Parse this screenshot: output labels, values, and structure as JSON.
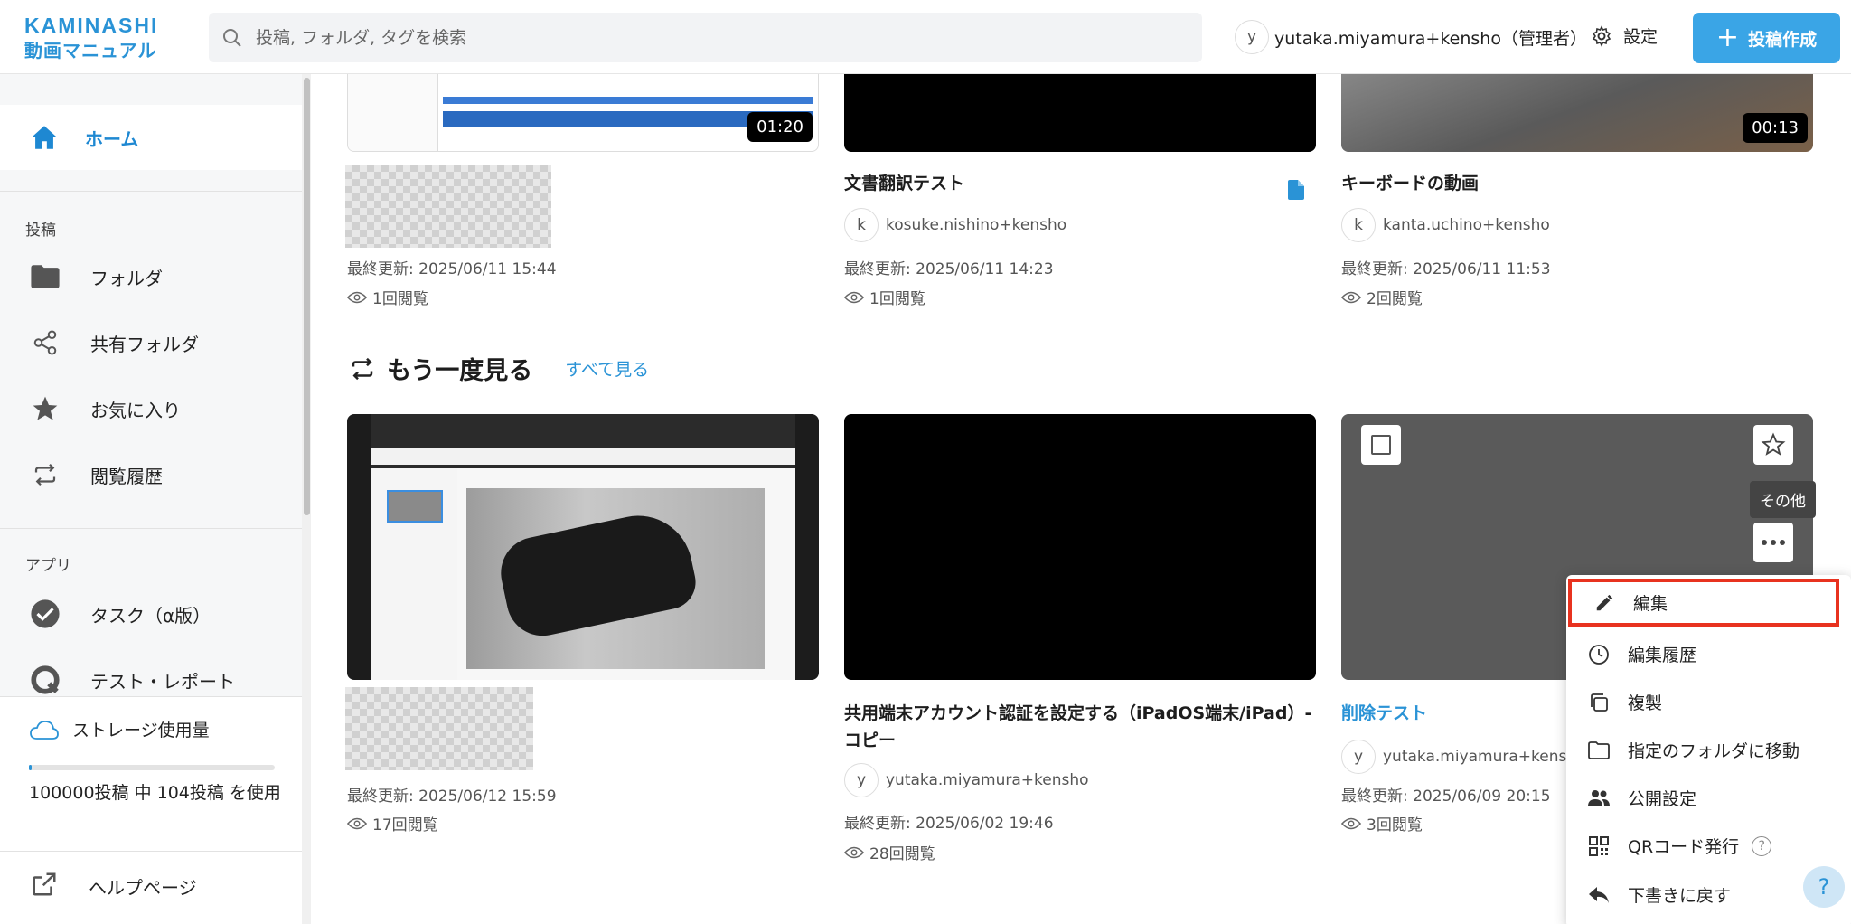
{
  "header": {
    "logo_line1": "KAMINASHI",
    "logo_line2": "動画マニュアル",
    "search_placeholder": "投稿, フォルダ, タグを検索",
    "user_initial": "y",
    "user_name": "yutaka.miyamura+kensho（管理者）",
    "settings_label": "設定",
    "new_post_label": "投稿作成"
  },
  "sidebar": {
    "home": "ホーム",
    "section_posts": "投稿",
    "folder": "フォルダ",
    "shared_folder": "共有フォルダ",
    "favorites": "お気に入り",
    "history": "閲覧履歴",
    "section_apps": "アプリ",
    "tasks": "タスク（α版）",
    "test_report": "テスト・レポート",
    "storage_title": "ストレージ使用量",
    "storage_count": "100000投稿 中 104投稿 を使用",
    "storage_used_fraction": 0.00104,
    "help_page": "ヘルプページ"
  },
  "row1": [
    {
      "duration": "01:20",
      "title": "",
      "author_initial": "",
      "author": "",
      "updated": "最終更新: 2025/06/11 15:44",
      "views": "1回閲覧"
    },
    {
      "duration": "",
      "title": "文書翻訳テスト",
      "author_initial": "k",
      "author": "kosuke.nishino+kensho",
      "updated": "最終更新: 2025/06/11 14:23",
      "views": "1回閲覧"
    },
    {
      "duration": "00:13",
      "title": "キーボードの動画",
      "author_initial": "k",
      "author": "kanta.uchino+kensho",
      "updated": "最終更新: 2025/06/11 11:53",
      "views": "2回閲覧"
    }
  ],
  "rewatch": {
    "title": "もう一度見る",
    "see_all": "すべて見る",
    "cards": [
      {
        "title": "",
        "author_initial": "",
        "author": "",
        "updated": "最終更新: 2025/06/12 15:59",
        "views": "17回閲覧"
      },
      {
        "title": "共用端末アカウント認証を設定する（iPadOS端末/iPad）- コピー",
        "author_initial": "y",
        "author": "yutaka.miyamura+kensho",
        "updated": "最終更新: 2025/06/02 19:46",
        "views": "28回閲覧"
      },
      {
        "title": "削除テスト",
        "author_initial": "y",
        "author": "yutaka.miyamura+kensho",
        "updated": "最終更新: 2025/06/09 20:15",
        "views": "3回閲覧"
      }
    ]
  },
  "tooltip": "その他",
  "menu": {
    "edit": "編集",
    "edit_history": "編集履歴",
    "duplicate": "複製",
    "move_to_folder": "指定のフォルダに移動",
    "visibility": "公開設定",
    "qr_code": "QRコード発行",
    "qr_help": "?",
    "revert_draft": "下書きに戻す"
  },
  "help_fab": "?",
  "colors": {
    "accent": "#2a93d6",
    "primary_button": "#3aa5e6",
    "highlight": "#e8321f"
  }
}
